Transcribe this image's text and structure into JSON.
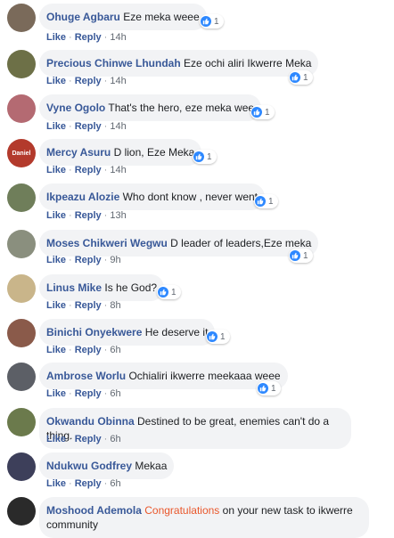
{
  "labels": {
    "like": "Like",
    "reply": "Reply",
    "sep": "·"
  },
  "colors": {
    "author": "#385898",
    "bubble": "#f2f3f5",
    "like_blue": "#2d88ff",
    "mention": "#e9572b"
  },
  "comments": [
    {
      "author": "Ohuge Agbaru",
      "text": "Eze meka weee",
      "time": "14h",
      "reactions": "1",
      "avatar_color": "#7a6a5a"
    },
    {
      "author": "Precious Chinwe Lhundah",
      "text": "Eze ochi aliri Ikwerre Meka",
      "time": "14h",
      "reactions": "1",
      "avatar_color": "#6d7047"
    },
    {
      "author": "Vyne Ogolo",
      "text": "That's the hero, eze meka wee",
      "time": "14h",
      "reactions": "1",
      "avatar_color": "#b46a72"
    },
    {
      "author": "Mercy Asuru",
      "text": "D lion, Eze Meka",
      "time": "14h",
      "reactions": "1",
      "avatar_color": "#b33a2c",
      "avatar_text": "Daniel"
    },
    {
      "author": "Ikpeazu Alozie",
      "text": "Who dont know , never went",
      "time": "13h",
      "reactions": "1",
      "avatar_color": "#6f7e5a"
    },
    {
      "author": "Moses Chikweri Wegwu",
      "text": "D leader of leaders,Eze meka",
      "time": "9h",
      "reactions": "1",
      "avatar_color": "#8a8f7e"
    },
    {
      "author": "Linus Mike",
      "text": "Is he God?",
      "time": "8h",
      "reactions": "1",
      "avatar_color": "#c9b58a"
    },
    {
      "author": "Binichi Onyekwere",
      "text": "He deserve it",
      "time": "6h",
      "reactions": "1",
      "avatar_color": "#8a5a4a"
    },
    {
      "author": "Ambrose Worlu",
      "text": "Ochialiri ikwerre meekaaa weee",
      "time": "6h",
      "reactions": "1",
      "avatar_color": "#5c5f66"
    },
    {
      "author": "Okwandu Obinna",
      "text": "Destined to be great, enemies can't do a thing.",
      "time": "6h",
      "reactions": "",
      "avatar_color": "#6b7a4c"
    },
    {
      "author": "Ndukwu Godfrey",
      "text": "Mekaa",
      "time": "6h",
      "reactions": "",
      "avatar_color": "#3d3f5a"
    },
    {
      "author": "Moshood Ademola",
      "mention": "Congratulations",
      "text": "on your new task to ikwerre community",
      "time": "",
      "reactions": "",
      "avatar_color": "#2a2a2a"
    }
  ]
}
